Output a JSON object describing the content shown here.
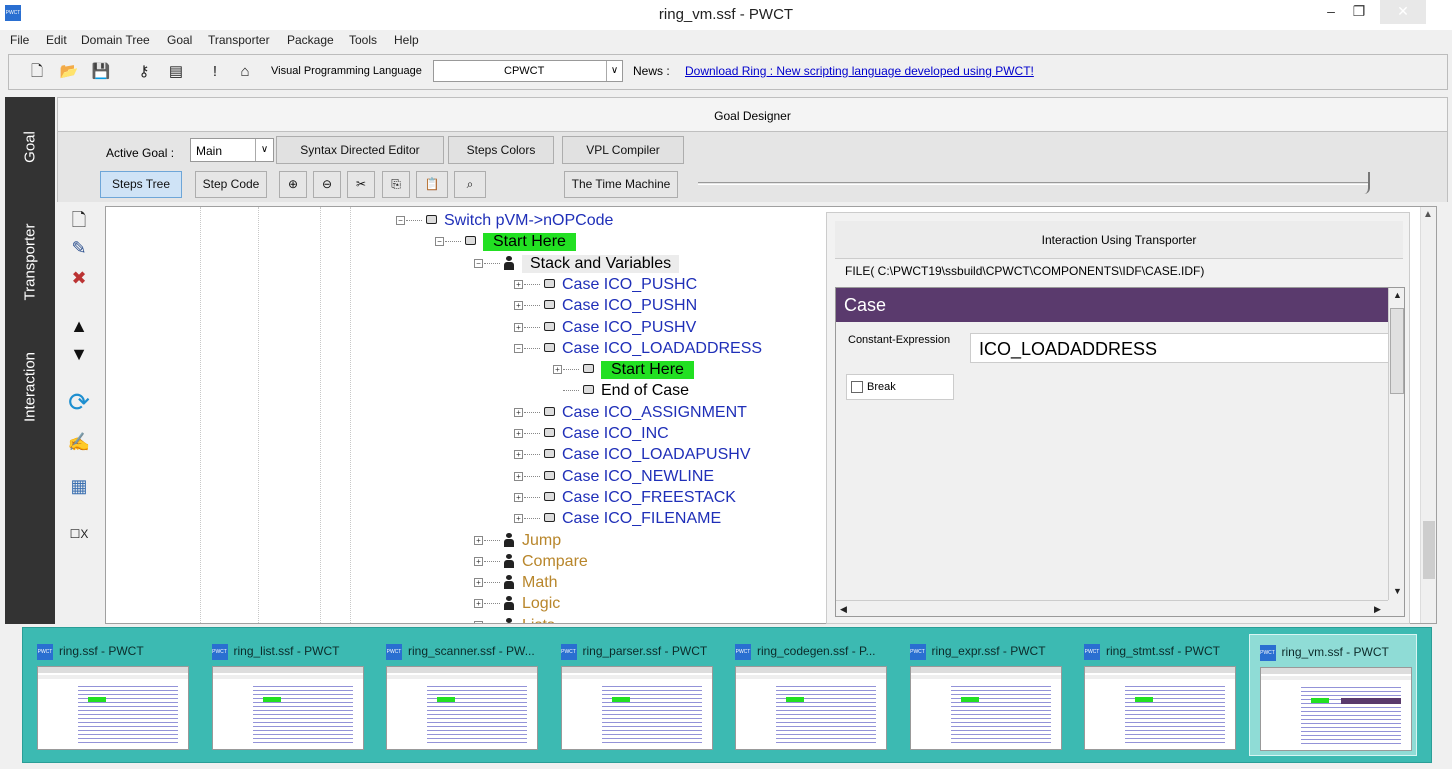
{
  "window": {
    "title": "ring_vm.ssf  - PWCT",
    "app_icon": "PWCT",
    "min_glyph": "–",
    "max_glyph": "❐",
    "close_glyph": "✕"
  },
  "menu": [
    "File",
    "Edit",
    "Domain Tree",
    "Goal",
    "Transporter",
    "Package",
    "Tools",
    "Help"
  ],
  "toolbar": {
    "vpl_label": "Visual Programming Language",
    "vpl_value": "CPWCT",
    "news_label": "News :",
    "news_link": "Download Ring : New scripting language developed using PWCT!",
    "icons": [
      "new-file-icon",
      "open-folder-icon",
      "save-icon",
      "key-icon",
      "report-icon",
      "exclamation-icon",
      "open-box-icon"
    ]
  },
  "side_tabs": [
    "Goal",
    "Transporter",
    "Interaction"
  ],
  "designer": {
    "title": "Goal Designer",
    "active_goal_label": "Active Goal :",
    "active_goal_value": "Main",
    "buttons": [
      "Syntax Directed Editor",
      "Steps Colors",
      "VPL Compiler"
    ],
    "tool_buttons": [
      "Steps Tree",
      "Step Code",
      "The Time Machine"
    ]
  },
  "steps_tree": [
    {
      "label": "Switch pVM->nOPCode",
      "style": "blue",
      "icon": "step",
      "toggle": "−"
    },
    {
      "label": "Start Here",
      "style": "hl",
      "icon": "step",
      "toggle": "−"
    },
    {
      "label": "Stack and Variables",
      "style": "grey",
      "icon": "person",
      "toggle": "−"
    },
    {
      "label": "Case ICO_PUSHC",
      "style": "blue",
      "icon": "step",
      "toggle": "+"
    },
    {
      "label": "Case ICO_PUSHN",
      "style": "blue",
      "icon": "step",
      "toggle": "+"
    },
    {
      "label": "Case ICO_PUSHV",
      "style": "blue",
      "icon": "step",
      "toggle": "+"
    },
    {
      "label": "Case ICO_LOADADDRESS",
      "style": "blue",
      "icon": "step",
      "toggle": "−"
    },
    {
      "label": "Start Here",
      "style": "hl",
      "icon": "step",
      "toggle": "+"
    },
    {
      "label": "End of Case",
      "style": "plain",
      "icon": "step",
      "toggle": ""
    },
    {
      "label": "Case ICO_ASSIGNMENT",
      "style": "blue",
      "icon": "step",
      "toggle": "+"
    },
    {
      "label": "Case ICO_INC",
      "style": "blue",
      "icon": "step",
      "toggle": "+"
    },
    {
      "label": "Case ICO_LOADAPUSHV",
      "style": "blue",
      "icon": "step",
      "toggle": "+"
    },
    {
      "label": "Case ICO_NEWLINE",
      "style": "blue",
      "icon": "step",
      "toggle": "+"
    },
    {
      "label": "Case ICO_FREESTACK",
      "style": "blue",
      "icon": "step",
      "toggle": "+"
    },
    {
      "label": "Case ICO_FILENAME",
      "style": "blue",
      "icon": "step",
      "toggle": "+"
    },
    {
      "label": "Jump",
      "style": "gold",
      "icon": "person",
      "toggle": "+"
    },
    {
      "label": "Compare",
      "style": "gold",
      "icon": "person",
      "toggle": "+"
    },
    {
      "label": "Math",
      "style": "gold",
      "icon": "person",
      "toggle": "+"
    },
    {
      "label": "Logic",
      "style": "gold",
      "icon": "person",
      "toggle": "+"
    },
    {
      "label": "Lists",
      "style": "gold",
      "icon": "person",
      "toggle": "+"
    }
  ],
  "interaction": {
    "header": "Interaction Using Transporter",
    "file": "FILE( C:\\PWCT19\\ssbuild\\CPWCT\\COMPONENTS\\IDF\\CASE.IDF)",
    "form_title": "Case",
    "const_label": "Constant-Expression",
    "const_value": "ICO_LOADADDRESS",
    "break_label": "Break"
  },
  "side_tools": {
    "x_label": "X"
  },
  "thumbnails": [
    {
      "title": "ring.ssf  - PWCT",
      "active": false
    },
    {
      "title": "ring_list.ssf  - PWCT",
      "active": false
    },
    {
      "title": "ring_scanner.ssf  - PW...",
      "active": false
    },
    {
      "title": "ring_parser.ssf  - PWCT",
      "active": false
    },
    {
      "title": "ring_codegen.ssf  - P...",
      "active": false
    },
    {
      "title": "ring_expr.ssf  - PWCT",
      "active": false
    },
    {
      "title": "ring_stmt.ssf  - PWCT",
      "active": false
    },
    {
      "title": "ring_vm.ssf  - PWCT",
      "active": true
    }
  ],
  "colors": {
    "tree_blue": "#1f2fb8",
    "tree_gold": "#b8862b",
    "highlight_green": "#22e022",
    "form_title_purple": "#5a3a6d",
    "taskbar_teal": "#3cbab2",
    "side_tab_dark": "#333333"
  }
}
